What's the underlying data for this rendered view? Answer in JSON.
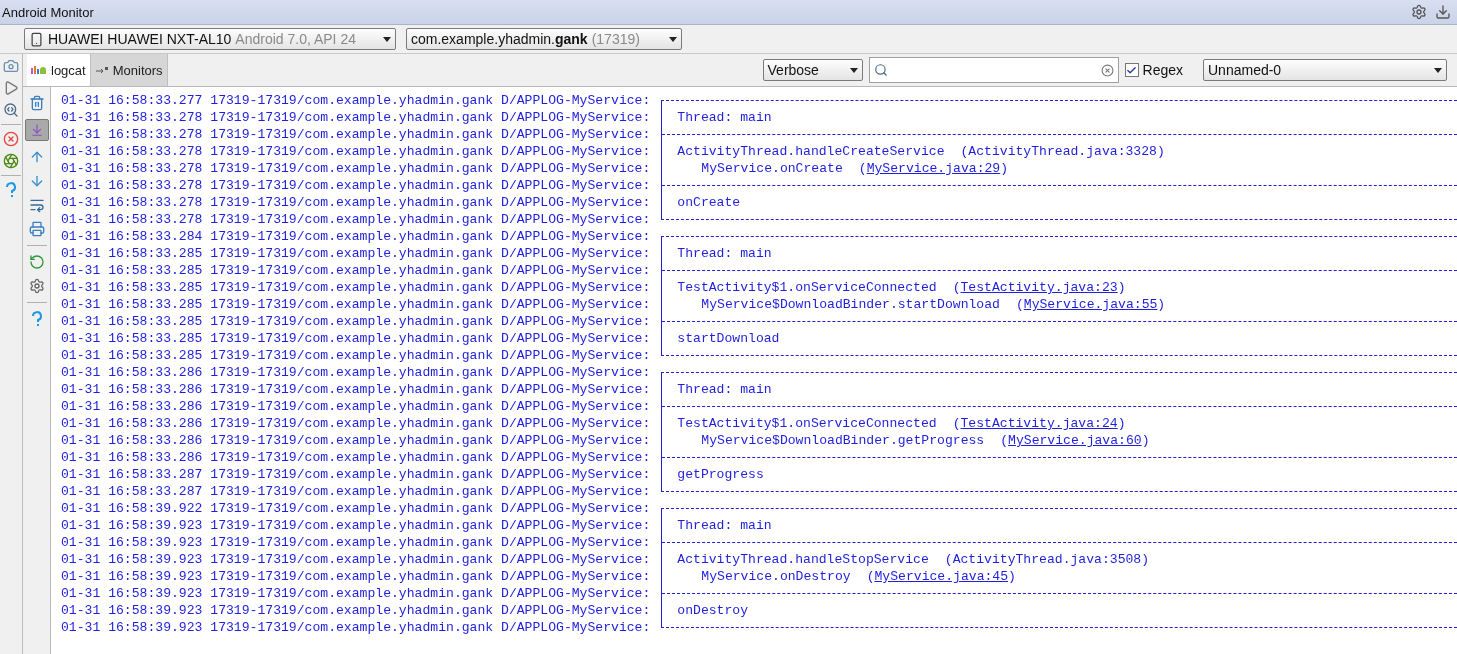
{
  "window": {
    "title": "Android Monitor"
  },
  "device": {
    "name": "HUAWEI HUAWEI NXT-AL10",
    "detail": "Android 7.0, API 24"
  },
  "process": {
    "name": "com.example.yhadmin.**gank**",
    "detail": "(17319)"
  },
  "tabs": [
    {
      "label": "logcat",
      "selected": true,
      "kind": "logcat"
    },
    {
      "label": "Monitors",
      "selected": false,
      "kind": "monitors"
    }
  ],
  "filter": {
    "level": "Verbose",
    "regex": {
      "label": "Regex",
      "checked": true
    },
    "preset": "Unnamed-0"
  },
  "log": [
    {
      "header": "01-31 16:58:33.277 17319-17319/com.example.yhadmin.gank D/APPLOG-MyService:",
      "kind": "top"
    },
    {
      "header": "01-31 16:58:33.278 17319-17319/com.example.yhadmin.gank D/APPLOG-MyService:",
      "kind": "text",
      "text": "Thread: main"
    },
    {
      "header": "01-31 16:58:33.278 17319-17319/com.example.yhadmin.gank D/APPLOG-MyService:",
      "kind": "sep"
    },
    {
      "header": "01-31 16:58:33.278 17319-17319/com.example.yhadmin.gank D/APPLOG-MyService:",
      "kind": "call",
      "text": "ActivityThread.handleCreateService",
      "source": {
        "open": "(",
        "file": "ActivityThread.java:3328",
        "close": ")",
        "linked": false
      }
    },
    {
      "header": "01-31 16:58:33.278 17319-17319/com.example.yhadmin.gank D/APPLOG-MyService:",
      "kind": "subcall",
      "text": "MyService.onCreate",
      "source": {
        "open": "(",
        "file": "MyService.java:29",
        "close": ")",
        "linked": true
      }
    },
    {
      "header": "01-31 16:58:33.278 17319-17319/com.example.yhadmin.gank D/APPLOG-MyService:",
      "kind": "sep"
    },
    {
      "header": "01-31 16:58:33.278 17319-17319/com.example.yhadmin.gank D/APPLOG-MyService:",
      "kind": "text",
      "text": "onCreate"
    },
    {
      "header": "01-31 16:58:33.278 17319-17319/com.example.yhadmin.gank D/APPLOG-MyService:",
      "kind": "bottom"
    },
    {
      "header": "01-31 16:58:33.284 17319-17319/com.example.yhadmin.gank D/APPLOG-MyService:",
      "kind": "top"
    },
    {
      "header": "01-31 16:58:33.285 17319-17319/com.example.yhadmin.gank D/APPLOG-MyService:",
      "kind": "text",
      "text": "Thread: main"
    },
    {
      "header": "01-31 16:58:33.285 17319-17319/com.example.yhadmin.gank D/APPLOG-MyService:",
      "kind": "sep"
    },
    {
      "header": "01-31 16:58:33.285 17319-17319/com.example.yhadmin.gank D/APPLOG-MyService:",
      "kind": "call",
      "text": "TestActivity$1.onServiceConnected",
      "source": {
        "open": "(",
        "file": "TestActivity.java:23",
        "close": ")",
        "linked": true
      }
    },
    {
      "header": "01-31 16:58:33.285 17319-17319/com.example.yhadmin.gank D/APPLOG-MyService:",
      "kind": "subcall",
      "text": "MyService$DownloadBinder.startDownload",
      "source": {
        "open": "(",
        "file": "MyService.java:55",
        "close": ")",
        "linked": true
      }
    },
    {
      "header": "01-31 16:58:33.285 17319-17319/com.example.yhadmin.gank D/APPLOG-MyService:",
      "kind": "sep"
    },
    {
      "header": "01-31 16:58:33.285 17319-17319/com.example.yhadmin.gank D/APPLOG-MyService:",
      "kind": "text",
      "text": "startDownload"
    },
    {
      "header": "01-31 16:58:33.285 17319-17319/com.example.yhadmin.gank D/APPLOG-MyService:",
      "kind": "bottom"
    },
    {
      "header": "01-31 16:58:33.286 17319-17319/com.example.yhadmin.gank D/APPLOG-MyService:",
      "kind": "top"
    },
    {
      "header": "01-31 16:58:33.286 17319-17319/com.example.yhadmin.gank D/APPLOG-MyService:",
      "kind": "text",
      "text": "Thread: main"
    },
    {
      "header": "01-31 16:58:33.286 17319-17319/com.example.yhadmin.gank D/APPLOG-MyService:",
      "kind": "sep"
    },
    {
      "header": "01-31 16:58:33.286 17319-17319/com.example.yhadmin.gank D/APPLOG-MyService:",
      "kind": "call",
      "text": "TestActivity$1.onServiceConnected",
      "source": {
        "open": "(",
        "file": "TestActivity.java:24",
        "close": ")",
        "linked": true
      }
    },
    {
      "header": "01-31 16:58:33.286 17319-17319/com.example.yhadmin.gank D/APPLOG-MyService:",
      "kind": "subcall",
      "text": "MyService$DownloadBinder.getProgress",
      "source": {
        "open": "(",
        "file": "MyService.java:60",
        "close": ")",
        "linked": true
      }
    },
    {
      "header": "01-31 16:58:33.286 17319-17319/com.example.yhadmin.gank D/APPLOG-MyService:",
      "kind": "sep"
    },
    {
      "header": "01-31 16:58:33.287 17319-17319/com.example.yhadmin.gank D/APPLOG-MyService:",
      "kind": "text",
      "text": "getProgress"
    },
    {
      "header": "01-31 16:58:33.287 17319-17319/com.example.yhadmin.gank D/APPLOG-MyService:",
      "kind": "bottom"
    },
    {
      "header": "01-31 16:58:39.922 17319-17319/com.example.yhadmin.gank D/APPLOG-MyService:",
      "kind": "top"
    },
    {
      "header": "01-31 16:58:39.923 17319-17319/com.example.yhadmin.gank D/APPLOG-MyService:",
      "kind": "text",
      "text": "Thread: main"
    },
    {
      "header": "01-31 16:58:39.923 17319-17319/com.example.yhadmin.gank D/APPLOG-MyService:",
      "kind": "sep"
    },
    {
      "header": "01-31 16:58:39.923 17319-17319/com.example.yhadmin.gank D/APPLOG-MyService:",
      "kind": "call",
      "text": "ActivityThread.handleStopService",
      "source": {
        "open": "(",
        "file": "ActivityThread.java:3508",
        "close": ")",
        "linked": false
      }
    },
    {
      "header": "01-31 16:58:39.923 17319-17319/com.example.yhadmin.gank D/APPLOG-MyService:",
      "kind": "subcall",
      "text": "MyService.onDestroy",
      "source": {
        "open": "(",
        "file": "MyService.java:45",
        "close": ")",
        "linked": true
      }
    },
    {
      "header": "01-31 16:58:39.923 17319-17319/com.example.yhadmin.gank D/APPLOG-MyService:",
      "kind": "sep"
    },
    {
      "header": "01-31 16:58:39.923 17319-17319/com.example.yhadmin.gank D/APPLOG-MyService:",
      "kind": "text",
      "text": "onDestroy"
    },
    {
      "header": "01-31 16:58:39.923 17319-17319/com.example.yhadmin.gank D/APPLOG-MyService:",
      "kind": "bottom"
    }
  ]
}
